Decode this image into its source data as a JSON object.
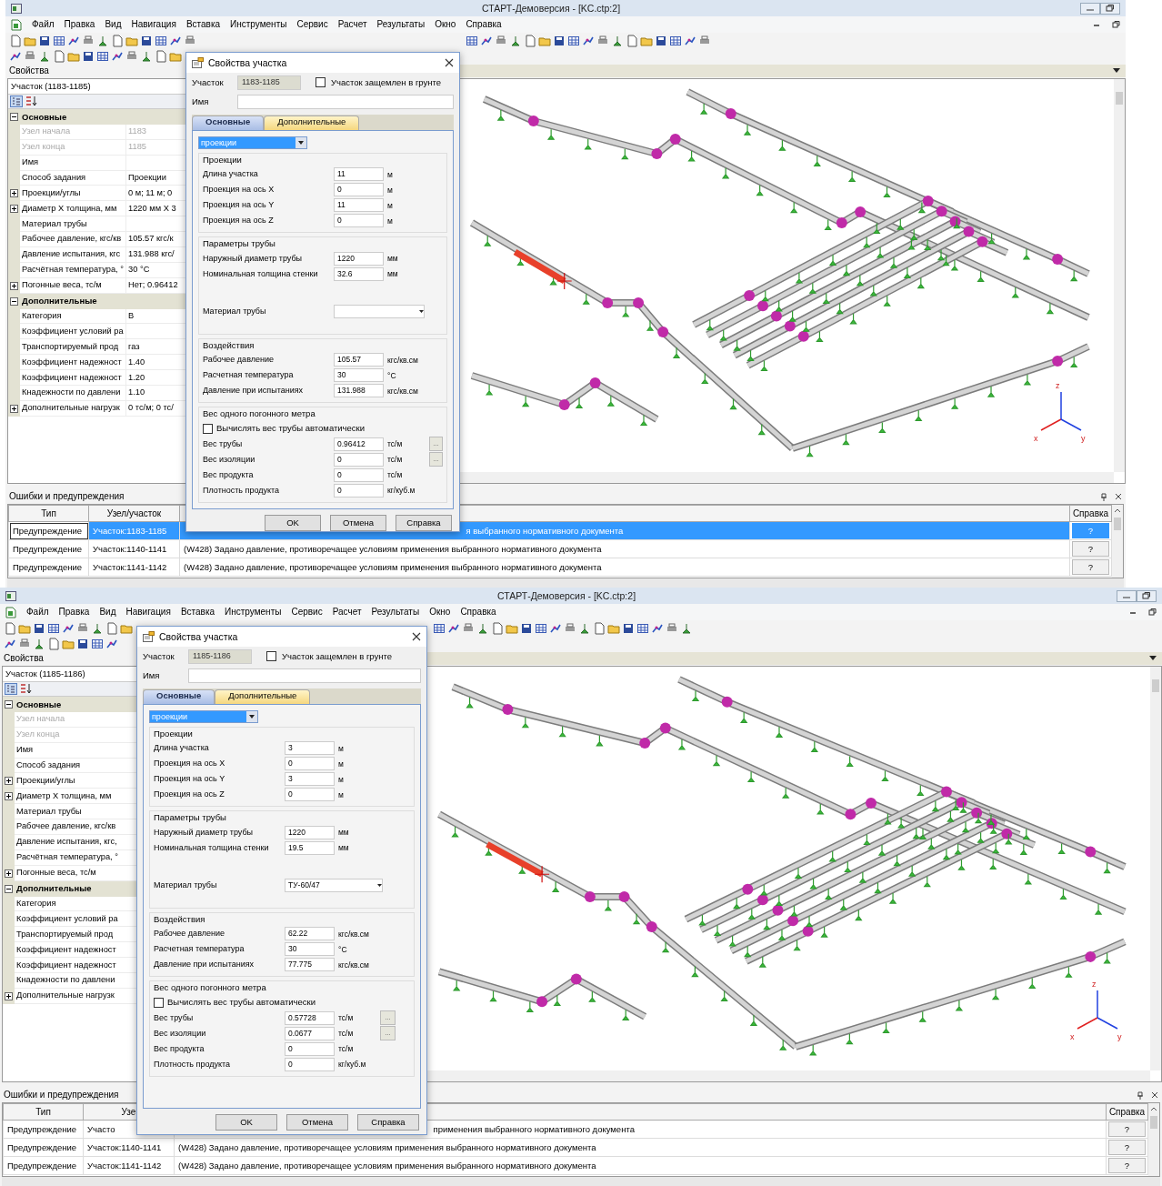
{
  "screens": [
    {
      "window": {
        "title": "СТАРТ-Демоверсия - [KC.ctp:2]"
      },
      "menu": [
        "Файл",
        "Правка",
        "Вид",
        "Навигация",
        "Вставка",
        "Инструменты",
        "Сервис",
        "Расчет",
        "Результаты",
        "Окно",
        "Справка"
      ],
      "properties_panel": {
        "title": "Свойства",
        "object": "Участок (1183-1185)",
        "groups": [
          {
            "label": "Основные",
            "expanded": true,
            "rows": [
              {
                "name": "Узел начала",
                "value": "1183",
                "disabled": true
              },
              {
                "name": "Узел конца",
                "value": "1185",
                "disabled": true
              },
              {
                "name": "Имя",
                "disabled": false
              },
              {
                "name": "Способ задания",
                "value": "Проекции",
                "disabled": false
              },
              {
                "name": "Проекции/углы",
                "value": "0 м; 11 м; 0",
                "disabled": false,
                "expanded": false
              },
              {
                "name": "Диаметр X толщина, мм",
                "value": "1220 мм X 3",
                "disabled": false,
                "expanded": false
              },
              {
                "name": "Материал трубы",
                "disabled": false
              },
              {
                "name": "Рабочее давление, кгс/кв",
                "value": "105.57 кгс/к",
                "disabled": false
              },
              {
                "name": "Давление испытания, кгс",
                "value": "131.988 кгс/",
                "disabled": false
              },
              {
                "name": "Расчётная температура, °",
                "value": "30 °C",
                "disabled": false
              },
              {
                "name": "Погонные веса, тс/м",
                "value": "Нет; 0.96412",
                "disabled": false,
                "expanded": false
              }
            ]
          },
          {
            "label": "Дополнительные",
            "expanded": true,
            "rows": [
              {
                "name": "Категория",
                "value": "В",
                "disabled": false
              },
              {
                "name": "Коэффициент условий ра",
                "disabled": false
              },
              {
                "name": "Транспортируемый прод",
                "value": "газ",
                "disabled": false
              },
              {
                "name": "Коэффициент надежност",
                "value": "1.40",
                "disabled": false
              },
              {
                "name": "Коэффициент надежност",
                "value": "1.20",
                "disabled": false
              },
              {
                "name": "Кнадежности по давлени",
                "value": "1.10",
                "disabled": false
              },
              {
                "name": "Дополнительные нагрузк",
                "value": "0 тс/м; 0 тс/",
                "disabled": false,
                "expanded": false
              }
            ]
          }
        ]
      },
      "viewport": {
        "axis_labels": [
          "z",
          "x",
          "y"
        ]
      },
      "errors_panel": {
        "title": "Ошибки и предупреждения",
        "columns": [
          "Тип",
          "Узел/участок",
          "Справка"
        ],
        "rows": [
          {
            "type": "Предупреждение",
            "node": "Участок:1183-1185",
            "message": "я выбранного нормативного документа",
            "help": "?",
            "selected": true
          },
          {
            "type": "Предупреждение",
            "node": "Участок:1140-1141",
            "message": "(W428) Задано давление, противоречащее условиям применения выбранного нормативного документа",
            "help": "?",
            "selected": false
          },
          {
            "type": "Предупреждение",
            "node": "Участок:1141-1142",
            "message": "(W428) Задано давление, противоречащее условиям применения выбранного нормативного документа",
            "help": "?",
            "selected": false
          }
        ]
      },
      "dialog": {
        "title": "Свойства участка",
        "section_label": "Участок",
        "section_value": "1183-1185",
        "fixed_in_ground": {
          "label": "Участок защемлен в грунте",
          "checked": false
        },
        "name_label": "Имя",
        "tabs": [
          {
            "label": "Основные",
            "selected": true
          },
          {
            "label": "Дополнительные",
            "selected": false
          }
        ],
        "mode": "проекции",
        "groups": [
          {
            "title": "Проекции",
            "fields": [
              {
                "kind": "input",
                "label": "Длина участка",
                "value": "11",
                "unit": "м"
              },
              {
                "kind": "input",
                "label": "Проекция на ось X",
                "value": "0",
                "unit": "м"
              },
              {
                "kind": "input",
                "label": "Проекция на ось Y",
                "value": "11",
                "unit": "м"
              },
              {
                "kind": "input",
                "label": "Проекция на ось Z",
                "value": "0",
                "unit": "м"
              }
            ]
          },
          {
            "title": "Параметры трубы",
            "fields": [
              {
                "kind": "input",
                "label": "Наружный диаметр трубы",
                "value": "1220",
                "unit": "мм"
              },
              {
                "kind": "input",
                "label": "Номинальная толщина стенки",
                "value": "32.6",
                "unit": "мм"
              },
              {
                "kind": "select",
                "label": "Материал трубы"
              }
            ]
          },
          {
            "title": "Воздействия",
            "fields": [
              {
                "kind": "input",
                "label": "Рабочее давление",
                "value": "105.57",
                "unit": "кгс/кв.см"
              },
              {
                "kind": "input",
                "label": "Расчетная температура",
                "value": "30",
                "unit": "°C"
              },
              {
                "kind": "input",
                "label": "Давление при испытаниях",
                "value": "131.988",
                "unit": "кгс/кв.см"
              }
            ]
          },
          {
            "title": "Вес одного погонного метра",
            "fields": [
              {
                "kind": "checkbox",
                "label": "Вычислять вес трубы автоматически",
                "checked": false
              },
              {
                "kind": "input",
                "label": "Вес трубы",
                "value": "0.96412",
                "unit": "тс/м",
                "button": "..."
              },
              {
                "kind": "input",
                "label": "Вес изоляции",
                "value": "0",
                "unit": "тс/м",
                "button": "..."
              },
              {
                "kind": "input",
                "label": "Вес продукта",
                "value": "0",
                "unit": "тс/м"
              },
              {
                "kind": "input",
                "label": "Плотность продукта",
                "value": "0",
                "unit": "кг/куб.м"
              }
            ]
          }
        ],
        "buttons": [
          "OK",
          "Отмена",
          "Справка"
        ]
      }
    },
    {
      "window": {
        "title": "СТАРТ-Демоверсия - [KC.ctp:2]"
      },
      "menu": [
        "Файл",
        "Правка",
        "Вид",
        "Навигация",
        "Вставка",
        "Инструменты",
        "Сервис",
        "Расчет",
        "Результаты",
        "Окно",
        "Справка"
      ],
      "properties_panel": {
        "title": "Свойства",
        "object": "Участок (1185-1186)",
        "groups": [
          {
            "label": "Основные",
            "expanded": true,
            "rows": [
              {
                "name": "Узел начала",
                "disabled": true
              },
              {
                "name": "Узел конца",
                "disabled": true
              },
              {
                "name": "Имя",
                "disabled": false
              },
              {
                "name": "Способ задания",
                "disabled": false
              },
              {
                "name": "Проекции/углы",
                "disabled": false,
                "expanded": false
              },
              {
                "name": "Диаметр X толщина, мм",
                "disabled": false,
                "expanded": false
              },
              {
                "name": "Материал трубы",
                "disabled": false
              },
              {
                "name": "Рабочее давление, кгс/кв",
                "disabled": false
              },
              {
                "name": "Давление испытания, кгс,",
                "disabled": false
              },
              {
                "name": "Расчётная температура, °",
                "disabled": false
              },
              {
                "name": "Погонные веса, тс/м",
                "disabled": false,
                "expanded": false
              }
            ]
          },
          {
            "label": "Дополнительные",
            "expanded": true,
            "rows": [
              {
                "name": "Категория",
                "disabled": false
              },
              {
                "name": "Коэффициент условий ра",
                "disabled": false
              },
              {
                "name": "Транспортируемый прод",
                "disabled": false
              },
              {
                "name": "Коэффициент надежност",
                "disabled": false
              },
              {
                "name": "Коэффициент надежност",
                "disabled": false
              },
              {
                "name": "Кнадежности по давлени",
                "disabled": false
              },
              {
                "name": "Дополнительные нагрузк",
                "disabled": false,
                "expanded": false
              }
            ]
          }
        ]
      },
      "viewport": {
        "axis_labels": [
          "z",
          "x",
          "y"
        ]
      },
      "errors_panel": {
        "title": "Ошибки и предупреждения",
        "columns": [
          "Тип",
          "Узе",
          "Справка"
        ],
        "rows": [
          {
            "type": "Предупреждение",
            "node": "Участо",
            "message": "применения выбранного нормативного документа",
            "help": "?",
            "selected": false
          },
          {
            "type": "Предупреждение",
            "node": "Участок:1140-1141",
            "message": "(W428) Задано давление, противоречащее условиям применения выбранного нормативного документа",
            "help": "?",
            "selected": false
          },
          {
            "type": "Предупреждение",
            "node": "Участок:1141-1142",
            "message": "(W428) Задано давление, противоречащее условиям применения выбранного нормативного документа",
            "help": "?",
            "selected": false
          }
        ]
      },
      "dialog": {
        "title": "Свойства участка",
        "section_label": "Участок",
        "section_value": "1185-1186",
        "fixed_in_ground": {
          "label": "Участок защемлен в грунте",
          "checked": false
        },
        "name_label": "Имя",
        "tabs": [
          {
            "label": "Основные",
            "selected": true
          },
          {
            "label": "Дополнительные",
            "selected": false
          }
        ],
        "mode": "проекции",
        "groups": [
          {
            "title": "Проекции",
            "fields": [
              {
                "kind": "input",
                "label": "Длина участка",
                "value": "3",
                "unit": "м"
              },
              {
                "kind": "input",
                "label": "Проекция на ось X",
                "value": "0",
                "unit": "м"
              },
              {
                "kind": "input",
                "label": "Проекция на ось Y",
                "value": "3",
                "unit": "м"
              },
              {
                "kind": "input",
                "label": "Проекция на ось Z",
                "value": "0",
                "unit": "м"
              }
            ]
          },
          {
            "title": "Параметры трубы",
            "fields": [
              {
                "kind": "input",
                "label": "Наружный диаметр трубы",
                "value": "1220",
                "unit": "мм"
              },
              {
                "kind": "input",
                "label": "Номинальная толщина стенки",
                "value": "19.5",
                "unit": "мм"
              },
              {
                "kind": "select",
                "label": "Материал трубы",
                "value": "ТУ-60/47"
              }
            ]
          },
          {
            "title": "Воздействия",
            "fields": [
              {
                "kind": "input",
                "label": "Рабочее давление",
                "value": "62.22",
                "unit": "кгс/кв.см"
              },
              {
                "kind": "input",
                "label": "Расчетная температура",
                "value": "30",
                "unit": "°C"
              },
              {
                "kind": "input",
                "label": "Давление при испытаниях",
                "value": "77.775",
                "unit": "кгс/кв.см"
              }
            ]
          },
          {
            "title": "Вес одного погонного метра",
            "fields": [
              {
                "kind": "checkbox",
                "label": "Вычислять вес трубы автоматически",
                "checked": false
              },
              {
                "kind": "input",
                "label": "Вес трубы",
                "value": "0.57728",
                "unit": "тс/м",
                "button": "..."
              },
              {
                "kind": "input",
                "label": "Вес изоляции",
                "value": "0.0677",
                "unit": "тс/м",
                "button": "..."
              },
              {
                "kind": "input",
                "label": "Вес продукта",
                "value": "0",
                "unit": "тс/м"
              },
              {
                "kind": "input",
                "label": "Плотность продукта",
                "value": "0",
                "unit": "кг/куб.м"
              }
            ]
          }
        ],
        "buttons": [
          "OK",
          "Отмена",
          "Справка"
        ]
      }
    }
  ]
}
